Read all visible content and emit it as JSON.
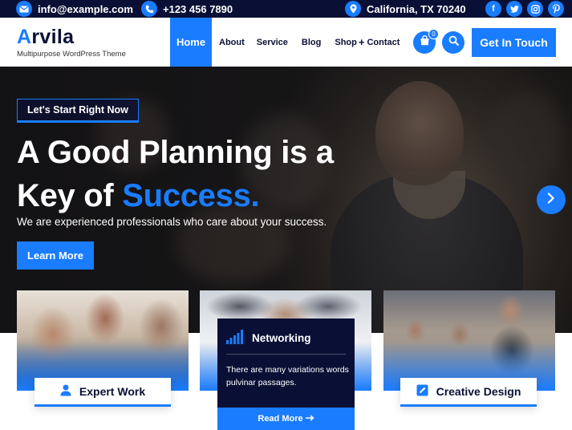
{
  "topbar": {
    "email": "info@example.com",
    "phone": "+123 456 7890",
    "location": "California, TX 70240",
    "socials": [
      "facebook-icon",
      "twitter-icon",
      "instagram-icon",
      "pinterest-icon"
    ]
  },
  "header": {
    "logo_first": "A",
    "logo_rest": "rvila",
    "tagline": "Multipurpose WordPress Theme",
    "nav": [
      "Home",
      "About",
      "Service",
      "Blog",
      "Shop",
      "Contact"
    ],
    "shop_plus": "+",
    "cart_count": "0",
    "cta": "Get In Touch"
  },
  "hero": {
    "badge": "Let's Start Right Now",
    "title_line1": "A Good Planning is a",
    "title_line2_plain": "Key of ",
    "title_line2_accent": "Success.",
    "description": "We are experienced professionals who care about your success.",
    "button": "Learn More"
  },
  "services": {
    "card1_label": "Expert Work",
    "card2_title": "Networking",
    "card2_desc": "There are many variations words pulvinar passages.",
    "card2_button": "Read More",
    "card3_label": "Creative Design"
  },
  "colors": {
    "accent": "#1a7cff",
    "navy": "#0a1035"
  }
}
